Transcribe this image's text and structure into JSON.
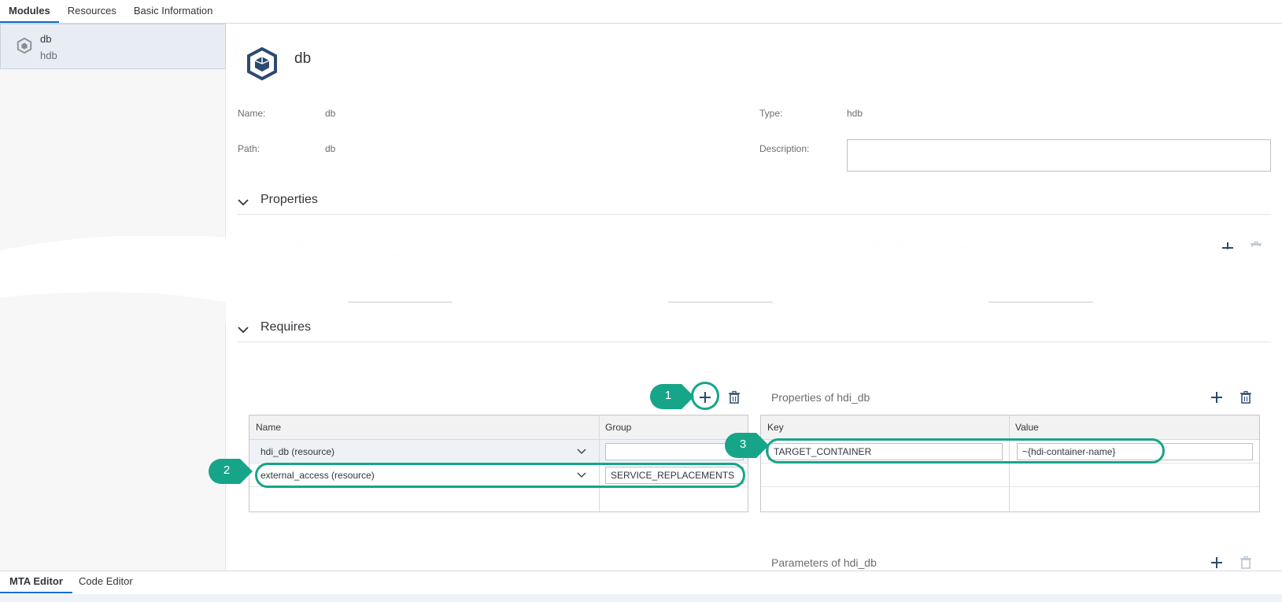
{
  "top_tabs": [
    "Modules",
    "Resources",
    "Basic Information"
  ],
  "sidebar": {
    "items": [
      {
        "name": "db",
        "type": "hdb"
      }
    ]
  },
  "module": {
    "title": "db",
    "name_label": "Name:",
    "name_value": "db",
    "path_label": "Path:",
    "path_value": "db",
    "type_label": "Type:",
    "type_value": "hdb",
    "description_label": "Description:",
    "description_value": ""
  },
  "sections": {
    "properties": "Properties",
    "requires": "Requires"
  },
  "requires_table": {
    "headers": [
      "Name",
      "Group"
    ],
    "rows": [
      {
        "name": "hdi_db (resource)",
        "group": ""
      },
      {
        "name": "external_access (resource)",
        "group": "SERVICE_REPLACEMENTS"
      }
    ]
  },
  "properties_panel": {
    "title": "Properties of hdi_db",
    "headers": [
      "Key",
      "Value"
    ],
    "rows": [
      {
        "key": "TARGET_CONTAINER",
        "value": "~{hdi-container-name}"
      }
    ]
  },
  "parameters_panel": {
    "title": "Parameters of hdi_db"
  },
  "callouts": [
    "1",
    "2",
    "3"
  ],
  "bottom_tabs": [
    "MTA Editor",
    "Code Editor"
  ],
  "colors": {
    "accent": "#17a589",
    "icon": "#2b4a6f",
    "tab_underline": "#0a6ed1"
  },
  "icons": [
    "cube-icon",
    "chevron-down-icon",
    "plus-icon",
    "trash-icon"
  ]
}
